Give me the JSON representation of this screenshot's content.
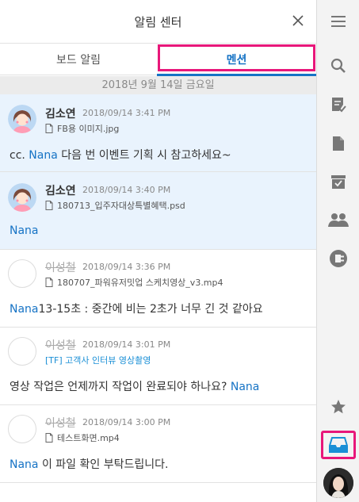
{
  "header": {
    "title": "알림 센터"
  },
  "tabs": {
    "board": "보드 알림",
    "mention": "멘션"
  },
  "date_separator": "2018년 9월 14일 금요일",
  "items": [
    {
      "name": "김소연",
      "time": "2018/09/14 3:41 PM",
      "file": "FB용 이미지.jpg",
      "msg_pre": "cc. ",
      "mention": "Nana",
      "msg_post": " 다음 번 이벤트 기획 시 참고하세요~"
    },
    {
      "name": "김소연",
      "time": "2018/09/14 3:40 PM",
      "file": "180713_입주자대상특별혜택.psd",
      "msg_pre": "",
      "mention": "Nana",
      "msg_post": ""
    },
    {
      "name": "이성철",
      "time": "2018/09/14 3:36 PM",
      "file": "180707_파워유저밋업 스케치영상_v3.mp4",
      "msg_pre": "",
      "mention": "Nana",
      "msg_post": "13-15초 : 중간에 비는 2초가 너무 긴 것 같아요"
    },
    {
      "name": "이성철",
      "time": "2018/09/14 3:01 PM",
      "topic": "[TF] 고객사 인터뷰 영상촬영",
      "msg_pre": "영상 작업은 언제까지 작업이 완료되야 하나요? ",
      "mention": "Nana",
      "msg_post": ""
    },
    {
      "name": "이성철",
      "time": "2018/09/14 3:00 PM",
      "file": "테스트화면.mp4",
      "msg_pre": "",
      "mention": "Nana",
      "msg_post": " 이 파일 확인 부탁드립니다."
    }
  ],
  "icons": {
    "menu": "menu-icon",
    "search": "search-icon",
    "todo": "todo-icon",
    "file": "file-icon",
    "archive": "archive-icon",
    "people": "people-icon",
    "plug": "connect-icon",
    "star": "star-icon",
    "inbox": "inbox-icon",
    "close": "close-icon"
  },
  "colors": {
    "accent": "#1673c5",
    "highlight": "#e8177a",
    "unread_bg": "#e9f3fd",
    "rail_bg": "#f3f3f3"
  }
}
